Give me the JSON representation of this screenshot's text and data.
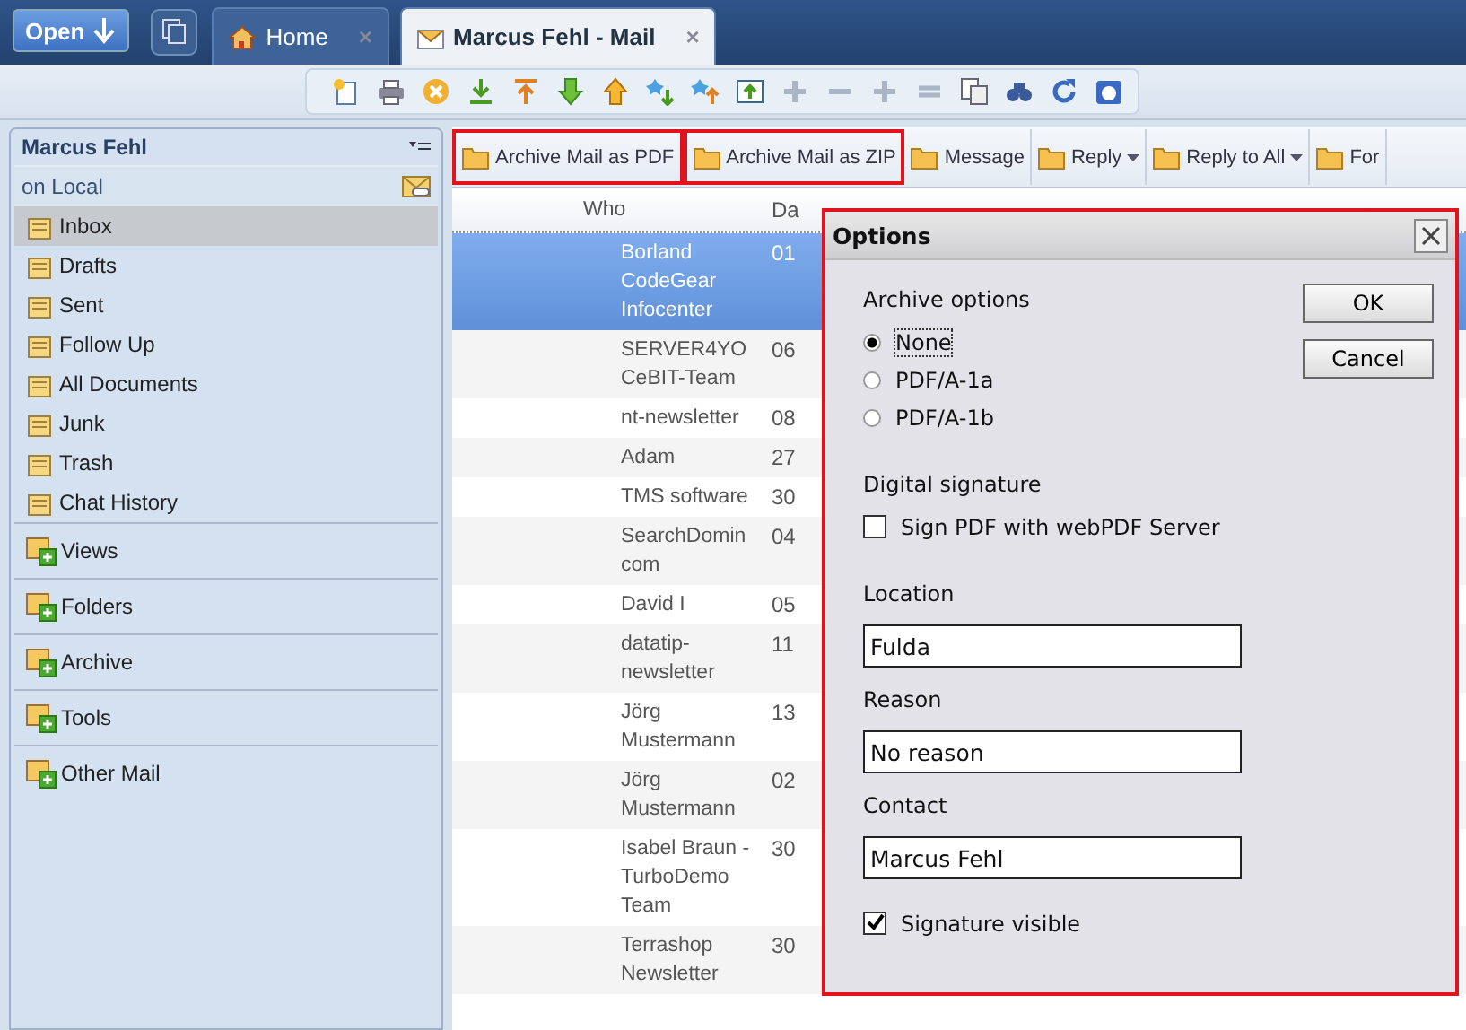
{
  "top_tabs": {
    "open_button": "Open",
    "tabs": [
      {
        "label": "Home",
        "close": "×",
        "selected": false
      },
      {
        "label": "Marcus Fehl - Mail",
        "close": "×",
        "selected": true
      }
    ]
  },
  "sidebar": {
    "title": "Marcus Fehl",
    "subtitle": "on Local",
    "items": [
      {
        "label": "Inbox",
        "selected": true
      },
      {
        "label": "Drafts",
        "selected": false
      },
      {
        "label": "Sent",
        "selected": false
      },
      {
        "label": "Follow Up",
        "selected": false
      },
      {
        "label": "All Documents",
        "selected": false
      },
      {
        "label": "Junk",
        "selected": false
      },
      {
        "label": "Trash",
        "selected": false
      },
      {
        "label": "Chat History",
        "selected": false
      }
    ],
    "sections": [
      "Views",
      "Folders",
      "Archive",
      "Tools",
      "Other Mail"
    ]
  },
  "action_bar": [
    {
      "label": "Archive Mail as PDF",
      "highlighted": true,
      "dropdown": false
    },
    {
      "label": "Archive Mail as ZIP",
      "highlighted": true,
      "dropdown": false
    },
    {
      "label": "Message",
      "highlighted": false,
      "dropdown": false
    },
    {
      "label": "Reply",
      "highlighted": false,
      "dropdown": true
    },
    {
      "label": "Reply to All",
      "highlighted": false,
      "dropdown": true
    },
    {
      "label": "For",
      "highlighted": false,
      "dropdown": false
    }
  ],
  "table": {
    "columns": [
      "Who",
      "Da"
    ],
    "rows": [
      {
        "who": "Borland CodeGear Infocenter",
        "date": "01",
        "selected": true
      },
      {
        "who": "SERVER4YO CeBIT-Team",
        "date": "06",
        "selected": false
      },
      {
        "who": "nt-newsletter",
        "date": "08",
        "selected": false
      },
      {
        "who": "Adam",
        "date": "27",
        "selected": false
      },
      {
        "who": "TMS software",
        "date": "30",
        "selected": false
      },
      {
        "who": "SearchDomin com",
        "date": "04",
        "selected": false
      },
      {
        "who": "David I",
        "date": "05",
        "selected": false
      },
      {
        "who": "datatip- newsletter",
        "date": "11",
        "selected": false
      },
      {
        "who": "Jörg Mustermann",
        "date": "13",
        "selected": false
      },
      {
        "who": "Jörg Mustermann",
        "date": "02",
        "selected": false
      },
      {
        "who": "Isabel Braun - TurboDemo Team",
        "date": "30",
        "selected": false
      },
      {
        "who": "Terrashop Newsletter",
        "date": "30",
        "selected": false
      }
    ]
  },
  "dialog": {
    "title": "Options",
    "archive_label": "Archive options",
    "archive_options": [
      {
        "label": "None",
        "selected": true
      },
      {
        "label": "PDF/A-1a",
        "selected": false
      },
      {
        "label": "PDF/A-1b",
        "selected": false
      }
    ],
    "signature_label": "Digital signature",
    "sign_checkbox": {
      "label": "Sign PDF with webPDF Server",
      "checked": false
    },
    "fields": [
      {
        "label": "Location",
        "value": "Fulda"
      },
      {
        "label": "Reason",
        "value": "No reason"
      },
      {
        "label": "Contact",
        "value": "Marcus Fehl"
      }
    ],
    "visible_checkbox": {
      "label": "Signature visible",
      "checked": true
    },
    "buttons": [
      "OK",
      "Cancel"
    ]
  }
}
